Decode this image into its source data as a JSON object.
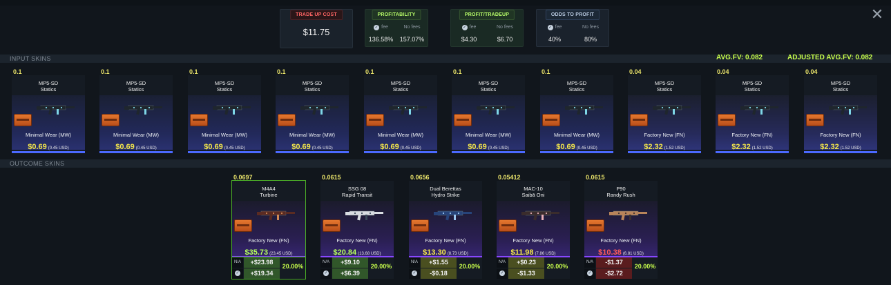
{
  "close_icon": "close-icon",
  "stats": {
    "cost": {
      "label": "TRADE UP COST",
      "value": "$11.75"
    },
    "profitability": {
      "label": "PROFITABILITY",
      "fee_label": "fee",
      "nofee_label": "No fees",
      "fee_value": "136.58%",
      "nofee_value": "157.07%"
    },
    "profit": {
      "label": "PROFIT/TRADEUP",
      "fee_label": "fee",
      "nofee_label": "No fees",
      "fee_value": "$4.30",
      "nofee_value": "$6.70"
    },
    "odds": {
      "label": "ODDS TO PROFIT",
      "fee_label": "fee",
      "nofee_label": "No fees",
      "fee_value": "40%",
      "nofee_value": "80%"
    }
  },
  "sections": {
    "input": "INPUT SKINS",
    "outcome": "OUTCOME SKINS"
  },
  "avg": {
    "avg_fv": "AVG.FV: 0.082",
    "adjusted": "ADJUSTED AVG.FV: 0.082"
  },
  "inputs": [
    {
      "float": "0.1",
      "name": "MP5-SD",
      "skin": "Statics",
      "wear": "Minimal Wear (MW)",
      "price": "$0.69",
      "usd": "(0.45 USD)"
    },
    {
      "float": "0.1",
      "name": "MP5-SD",
      "skin": "Statics",
      "wear": "Minimal Wear (MW)",
      "price": "$0.69",
      "usd": "(0.45 USD)"
    },
    {
      "float": "0.1",
      "name": "MP5-SD",
      "skin": "Statics",
      "wear": "Minimal Wear (MW)",
      "price": "$0.69",
      "usd": "(0.45 USD)"
    },
    {
      "float": "0.1",
      "name": "MP5-SD",
      "skin": "Statics",
      "wear": "Minimal Wear (MW)",
      "price": "$0.69",
      "usd": "(0.45 USD)"
    },
    {
      "float": "0.1",
      "name": "MP5-SD",
      "skin": "Statics",
      "wear": "Minimal Wear (MW)",
      "price": "$0.69",
      "usd": "(0.45 USD)"
    },
    {
      "float": "0.1",
      "name": "MP5-SD",
      "skin": "Statics",
      "wear": "Minimal Wear (MW)",
      "price": "$0.69",
      "usd": "(0.45 USD)"
    },
    {
      "float": "0.1",
      "name": "MP5-SD",
      "skin": "Statics",
      "wear": "Minimal Wear (MW)",
      "price": "$0.69",
      "usd": "(0.45 USD)"
    },
    {
      "float": "0.04",
      "name": "MP5-SD",
      "skin": "Statics",
      "wear": "Factory New (FN)",
      "price": "$2.32",
      "usd": "(1.52 USD)"
    },
    {
      "float": "0.04",
      "name": "MP5-SD",
      "skin": "Statics",
      "wear": "Factory New (FN)",
      "price": "$2.32",
      "usd": "(1.52 USD)"
    },
    {
      "float": "0.04",
      "name": "MP5-SD",
      "skin": "Statics",
      "wear": "Factory New (FN)",
      "price": "$2.32",
      "usd": "(1.52 USD)"
    }
  ],
  "outcomes": [
    {
      "float": "0.0697",
      "name": "M4A4",
      "skin": "Turbine",
      "wear": "Factory New (FN)",
      "price": "$35.73",
      "usd": "(23.45 USD)",
      "na": "N/A",
      "nofee": "+$23.98",
      "fee": "+$19.34",
      "pct": "20.00%",
      "selected": true,
      "price_color": "grn",
      "top_state": "pos",
      "bot_state": "pos"
    },
    {
      "float": "0.0615",
      "name": "SSG 08",
      "skin": "Rapid Transit",
      "wear": "Factory New (FN)",
      "price": "$20.84",
      "usd": "(13.68 USD)",
      "na": "N/A",
      "nofee": "+$9.10",
      "fee": "+$6.39",
      "pct": "20.00%",
      "selected": false,
      "price_color": "grn",
      "top_state": "pos",
      "bot_state": "pos"
    },
    {
      "float": "0.0656",
      "name": "Dual Berettas",
      "skin": "Hydro Strike",
      "wear": "Factory New (FN)",
      "price": "$13.30",
      "usd": "(8.73 USD)",
      "na": "N/A",
      "nofee": "+$1.55",
      "fee": "-$0.18",
      "pct": "20.00%",
      "selected": false,
      "price_color": "yel",
      "top_state": "mix",
      "bot_state": "mix"
    },
    {
      "float": "0.05412",
      "name": "MAC-10",
      "skin": "Saibā Oni",
      "wear": "Factory New (FN)",
      "price": "$11.98",
      "usd": "(7.86 USD)",
      "na": "N/A",
      "nofee": "+$0.23",
      "fee": "-$1.33",
      "pct": "20.00%",
      "selected": false,
      "price_color": "yel",
      "top_state": "mix",
      "bot_state": "mix"
    },
    {
      "float": "0.0615",
      "name": "P90",
      "skin": "Randy Rush",
      "wear": "Factory New (FN)",
      "price": "$10.38",
      "usd": "(6.81 USD)",
      "na": "N/A",
      "nofee": "-$1.37",
      "fee": "-$2.72",
      "pct": "20.00%",
      "selected": false,
      "price_color": "red",
      "top_state": "neg",
      "bot_state": "neg"
    }
  ]
}
